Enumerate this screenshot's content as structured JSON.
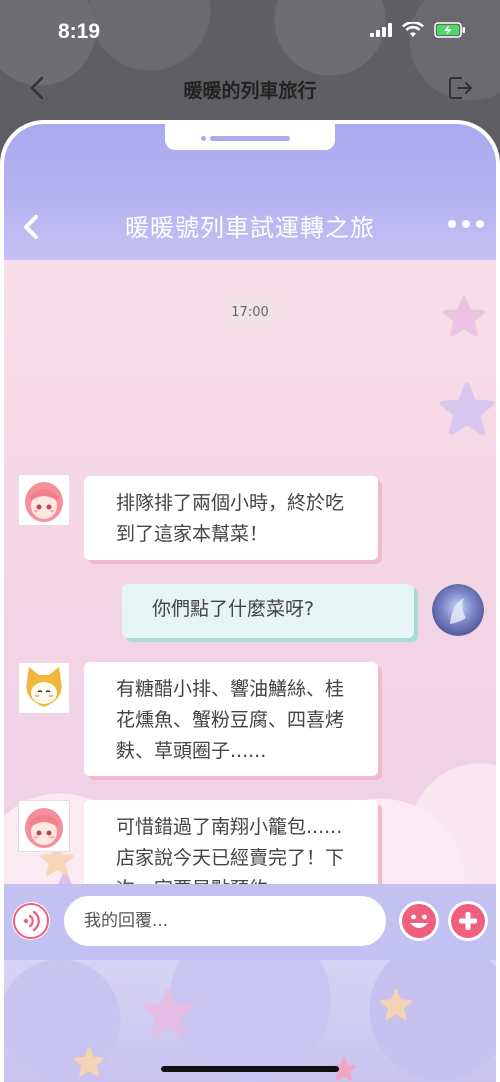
{
  "status_bar": {
    "time": "8:19"
  },
  "outer_header": {
    "title": "暖暖的列車旅行"
  },
  "chat": {
    "title": "暖暖號列車試運轉之旅",
    "timestamp": "17:00",
    "messages": [
      {
        "side": "left",
        "sender": "pink-hair-girl",
        "text": "排隊排了兩個小時，終於吃到了這家本幫菜！"
      },
      {
        "side": "right",
        "sender": "user",
        "text": "你們點了什麼菜呀?"
      },
      {
        "side": "left",
        "sender": "cat-hood-character",
        "text": "有糖醋小排、響油鱔絲、桂花燻魚、蟹粉豆腐、四喜烤麩、草頭圈子......"
      },
      {
        "side": "left",
        "sender": "pink-hair-girl",
        "text": "可惜錯過了南翔小籠包......店家說今天已經賣完了！下次一定要早點預約><"
      }
    ]
  },
  "input": {
    "placeholder": "我的回覆..."
  },
  "colors": {
    "header": "#b6b4f2",
    "bubble_shadow": "#f2b8cc",
    "right_bubble": "#e4f5f3",
    "input_bar": "#c3c1f2",
    "accent": "#f0607e"
  }
}
